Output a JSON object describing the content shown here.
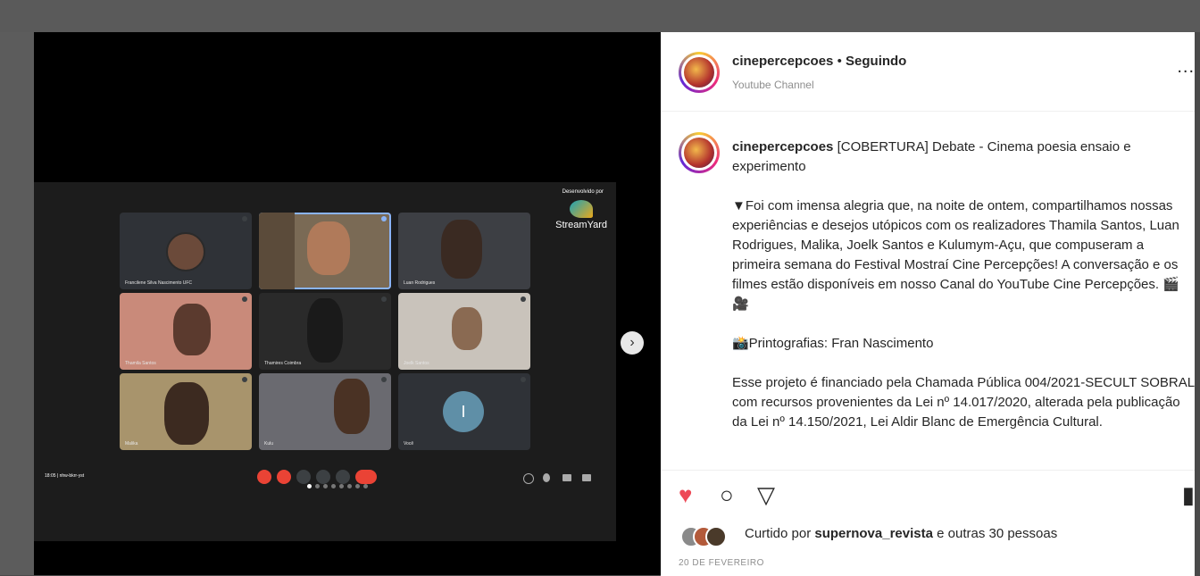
{
  "post": {
    "username": "cinepercepcoes",
    "separator": "•",
    "follow_status": "Seguindo",
    "subtitle": "Youtube Channel",
    "more_label": "...",
    "caption_title": "[COBERTURA] Debate - Cinema poesia ensaio e experimento",
    "paragraphs": [
      "▼Foi com imensa alegria que, na noite de ontem, compartilhamos nossas experiências e desejos utópicos com os realizadores Thamila Santos, Luan Rodrigues, Malika, Joelk Santos e Kulumym-Açu, que compuseram a primeira semana do Festival Mostraí Cine Percepções! A conversação e os filmes estão disponíveis em nosso Canal do YouTube Cine Percepções. 🎬🎥",
      "📸Printografias: Fran Nascimento",
      "Esse projeto é financiado pela Chamada Pública 004/2021-SECULT SOBRAL com recursos provenientes da Lei nº 14.017/2020, alterada pela publicação da Lei nº 14.150/2021, Lei Aldir Blanc de Emergência Cultural."
    ],
    "likes_prefix": "Curtido por",
    "likes_user": "supernova_revista",
    "likes_suffix": "e outras 30 pessoas",
    "date": "20 DE FEVEREIRO"
  },
  "stream": {
    "developed_by": "Desenvolvido por",
    "brand": "StreamYard",
    "time": "18:05",
    "meeting_code": "nhw-bkrr-yst",
    "tiles": [
      {
        "name": "Francilene Silva Nascimento UFC"
      },
      {
        "name": ""
      },
      {
        "name": "Luan Rodrigues"
      },
      {
        "name": "Thamila Santos"
      },
      {
        "name": "Thamires Coimbra"
      },
      {
        "name": "Joelk Santos"
      },
      {
        "name": "Malika"
      },
      {
        "name": "Kulu"
      },
      {
        "name": "Você",
        "letter": "I"
      }
    ],
    "carousel_count": 8,
    "carousel_active": 0
  },
  "icons": {
    "heart": "heart-icon",
    "comment": "comment-icon",
    "share": "share-icon",
    "bookmark": "bookmark-icon",
    "next": "chevron-right-icon"
  },
  "colors": {
    "like": "#ed4956",
    "accent": "#8ab4f8",
    "end_call": "#ea4335"
  }
}
